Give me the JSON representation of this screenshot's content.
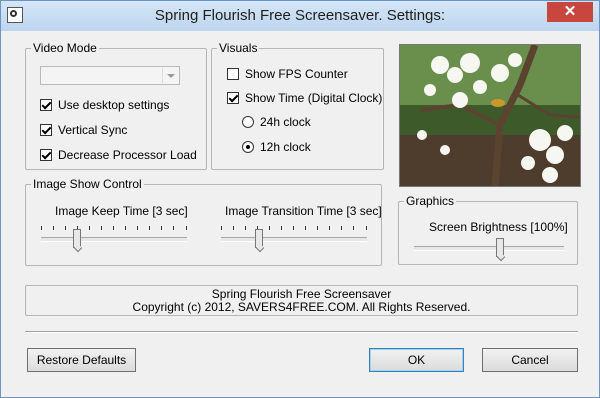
{
  "window": {
    "title": "Spring Flourish Free Screensaver. Settings:",
    "close_glyph": "✕"
  },
  "video_mode": {
    "legend": "Video Mode",
    "combo_value": "",
    "use_desktop_label": "Use desktop settings",
    "use_desktop_checked": true,
    "vsync_label": "Vertical Sync",
    "vsync_checked": true,
    "decrease_load_label": "Decrease Processor Load",
    "decrease_load_checked": true
  },
  "visuals": {
    "legend": "Visuals",
    "fps_label": "Show FPS Counter",
    "fps_checked": false,
    "time_label": "Show Time (Digital Clock)",
    "time_checked": true,
    "clock24_label": "24h clock",
    "clock24_selected": false,
    "clock12_label": "12h clock",
    "clock12_selected": true
  },
  "image_show": {
    "legend": "Image Show Control",
    "keep_time_label": "Image Keep Time [3 sec]",
    "keep_time_value": 3,
    "transition_label": "Image Transition Time [3 sec]",
    "transition_value": 3
  },
  "graphics": {
    "legend": "Graphics",
    "brightness_label": "Screen Brightness [100%]",
    "brightness_percent": 100
  },
  "info": {
    "line1": "Spring Flourish Free Screensaver",
    "line2": "Copyright (c) 2012, SAVERS4FREE.COM. All Rights Reserved."
  },
  "buttons": {
    "restore": "Restore Defaults",
    "ok": "OK",
    "cancel": "Cancel"
  },
  "icons": {
    "app": "screensaver-app-icon",
    "close": "close-icon",
    "preview": "blossom-preview-image"
  },
  "colors": {
    "title_bg": "#c9dcf0",
    "close_bg": "#c7463d",
    "dialog_bg": "#f0f0f0"
  }
}
